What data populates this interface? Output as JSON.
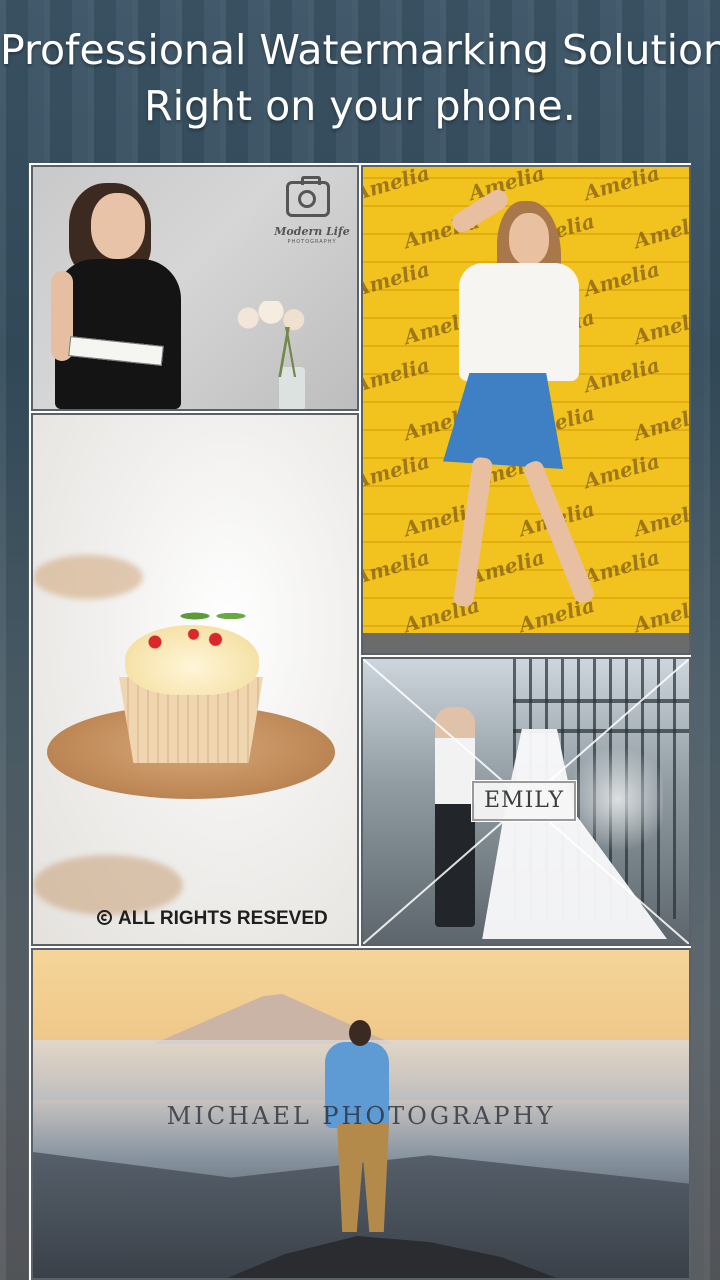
{
  "headline": {
    "line1": "Professional Watermarking Solution",
    "line2": "Right on your phone."
  },
  "tiles": [
    {
      "name": "woman-reading-photo",
      "watermark": {
        "brand": "Modern Life",
        "subtitle": "PHOTOGRAPHY",
        "icon": "camera-icon"
      }
    },
    {
      "name": "yellow-wall-photo",
      "watermark": {
        "text": "Amelia",
        "subtitle": "PHOTOGRAPHY",
        "repeated": true
      }
    },
    {
      "name": "cupcake-photo",
      "watermark": {
        "text": "ALL RIGHTS RESEVED",
        "icon": "copyright-icon"
      }
    },
    {
      "name": "wedding-photo",
      "watermark": {
        "text": "EMILY"
      }
    },
    {
      "name": "mountain-landscape-photo",
      "watermark": {
        "text": "MICHAEL PHOTOGRAPHY"
      }
    }
  ],
  "colors": {
    "background": "#3b5465",
    "headline_text": "#ffffff",
    "frame": "#ffffff",
    "yellow_wall": "#f2c21e"
  }
}
